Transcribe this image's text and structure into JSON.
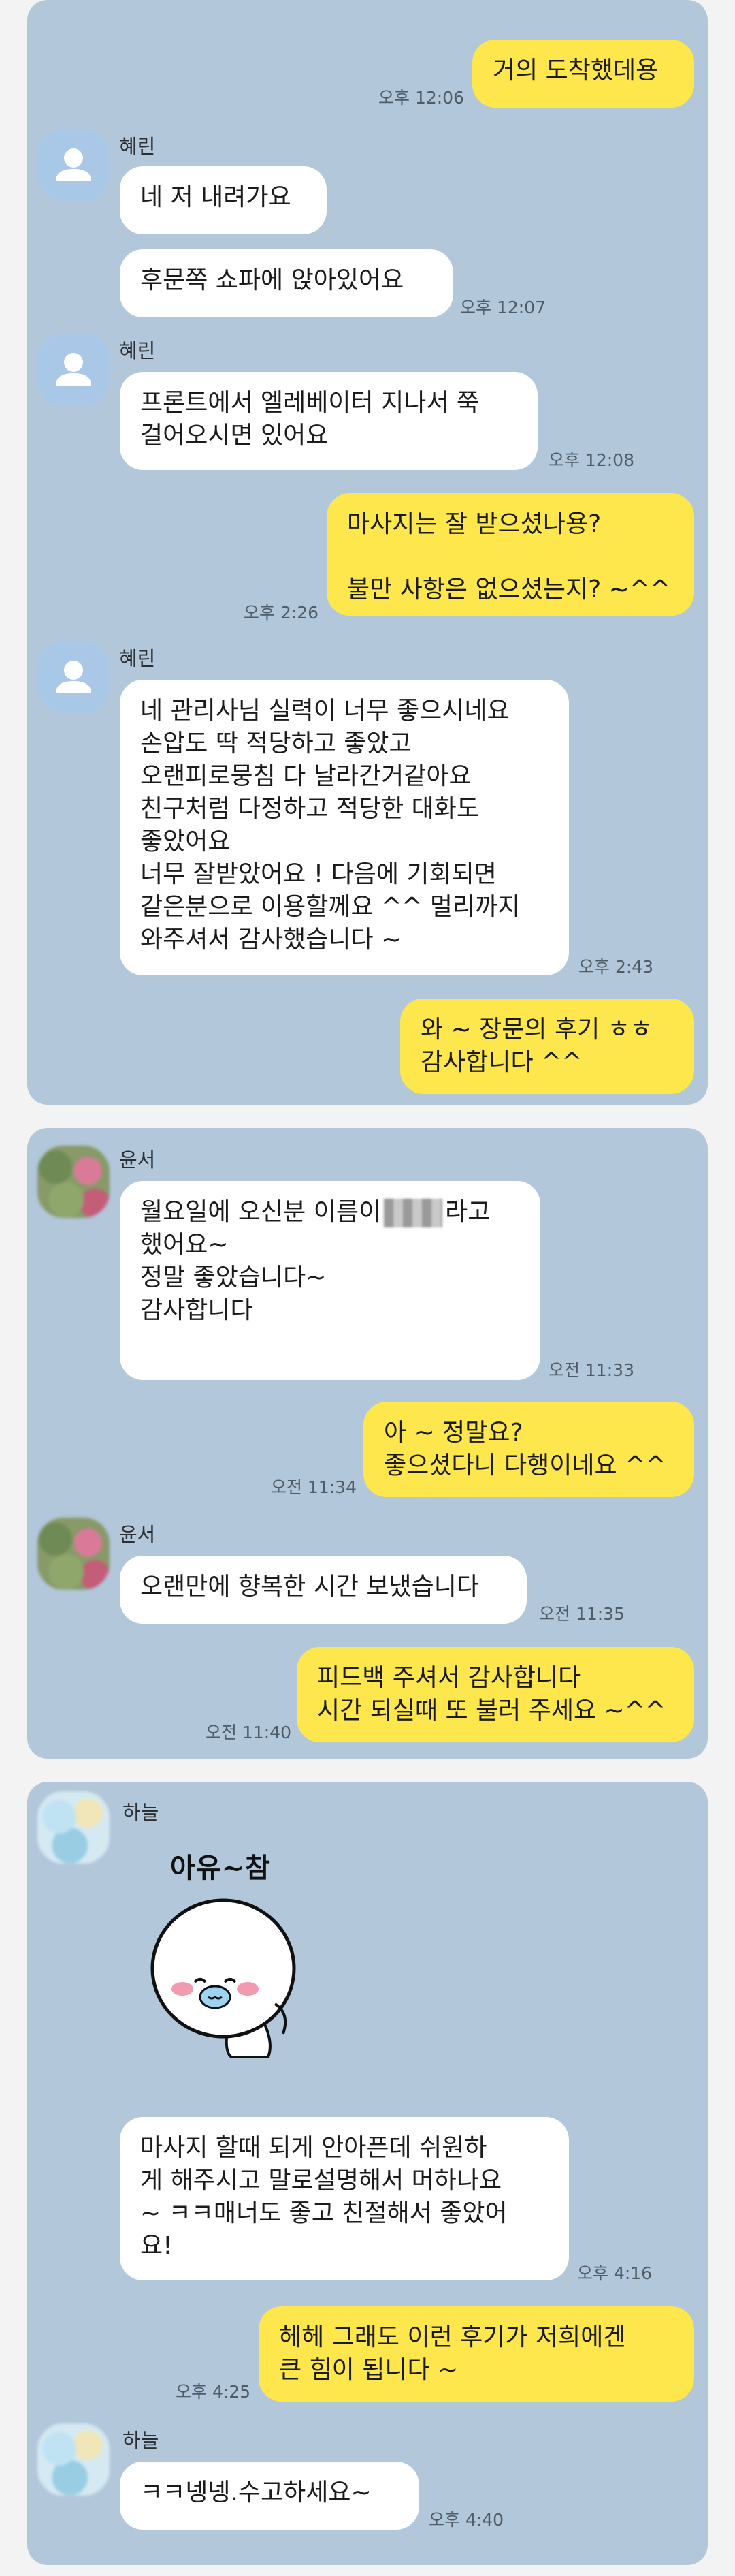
{
  "panel1": {
    "m1": {
      "text": "거의 도착했데용",
      "time": "오후 12:06"
    },
    "sender": "혜린",
    "m2": {
      "text": "네 저 내려가요"
    },
    "m3": {
      "text": "후문쪽 쇼파에 앉아있어요",
      "time": "오후 12:07"
    },
    "m4": {
      "text": "프론트에서 엘레베이터 지나서 쭉\n걸어오시면 있어요",
      "time": "오후 12:08"
    },
    "m5": {
      "text": "마사지는 잘 받으셨나용?\n\n불만 사항은 없으셨는지? ~^^",
      "time": "오후 2:26"
    },
    "m6": {
      "text": "네 관리사님 실력이 너무 좋으시네요\n손압도 딱 적당하고 좋았고\n오랜피로뭉침 다 날라간거같아요\n친구처럼 다정하고 적당한 대화도\n좋았어요\n너무 잘받았어요 ! 다음에 기회되면\n같은분으로 이용할께요 ^^ 멀리까지\n와주셔서 감사했습니다 ~",
      "time": "오후 2:43"
    },
    "m7": {
      "text": "와 ~ 장문의 후기 ㅎㅎ\n감사합니다 ^^"
    }
  },
  "panel2": {
    "sender": "윤서",
    "m1": {
      "line1a": "월요일에 오신분 이름이",
      "line1b": "라고",
      "rest": "했어요~\n정말 좋았습니다~\n감사합니다",
      "time": "오전 11:33"
    },
    "m2": {
      "text": "아 ~ 정말요?\n좋으셨다니 다행이네요 ^^",
      "time": "오전 11:34"
    },
    "m3": {
      "text": "오랜만에 향복한 시간 보냈습니다",
      "time": "오전 11:35"
    },
    "m4": {
      "text": "피드백 주셔서 감사합니다\n시간 되실때 또 불러 주세요 ~^^",
      "time": "오전 11:40"
    }
  },
  "panel3": {
    "sender": "하늘",
    "sticker": {
      "caption": "아유~참"
    },
    "m1": {
      "text": "마사지 할때 되게 안아픈데 쉬원하\n게 해주시고 말로설명해서 머하나요\n~ ㅋㅋ매너도 좋고 친절해서 좋았어\n요!",
      "time": "오후 4:16"
    },
    "m2": {
      "text": "헤헤 그래도 이런 후기가 저희에겐\n큰 힘이 됩니다 ~",
      "time": "오후 4:25"
    },
    "m3": {
      "text": "ㅋㅋ넹넹.수고하세요~",
      "time": "오후 4:40"
    }
  },
  "colors": {
    "mine": "#fde74d",
    "theirs": "#ffffff",
    "background": "#b2c7da"
  },
  "icons": [
    "default-profile-icon",
    "blurred-avatar",
    "emoticon-sticker"
  ]
}
